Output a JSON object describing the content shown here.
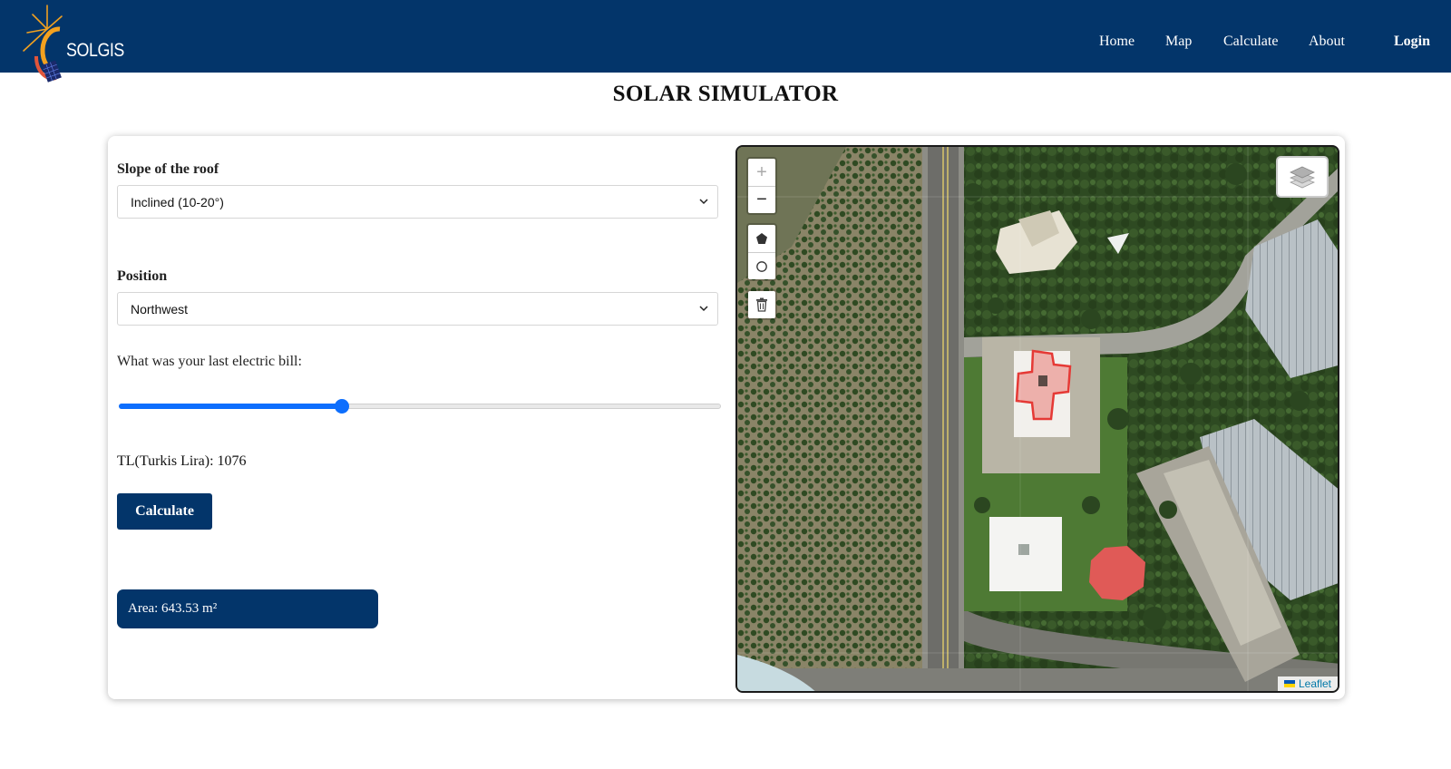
{
  "brand": {
    "name": "SOLGIS"
  },
  "nav": {
    "home": "Home",
    "map": "Map",
    "calculate": "Calculate",
    "about": "About",
    "login": "Login"
  },
  "page": {
    "title": "SOLAR SIMULATOR"
  },
  "form": {
    "slope": {
      "label": "Slope of the roof",
      "value": "Inclined (10-20°)"
    },
    "position": {
      "label": "Position",
      "value": "Northwest"
    },
    "bill": {
      "label": "What was your last electric bill:",
      "fraction": 0.37
    },
    "tl_text": "TL(Turkis Lira): 1076",
    "calculate_label": "Calculate",
    "area_text": "Area: 643.53 m²"
  },
  "map": {
    "zoom_in": "+",
    "zoom_out": "−",
    "attribution": "Leaflet"
  },
  "colors": {
    "navy": "#03356a",
    "slider": "#0d6efd",
    "polygon": "#e53935"
  }
}
